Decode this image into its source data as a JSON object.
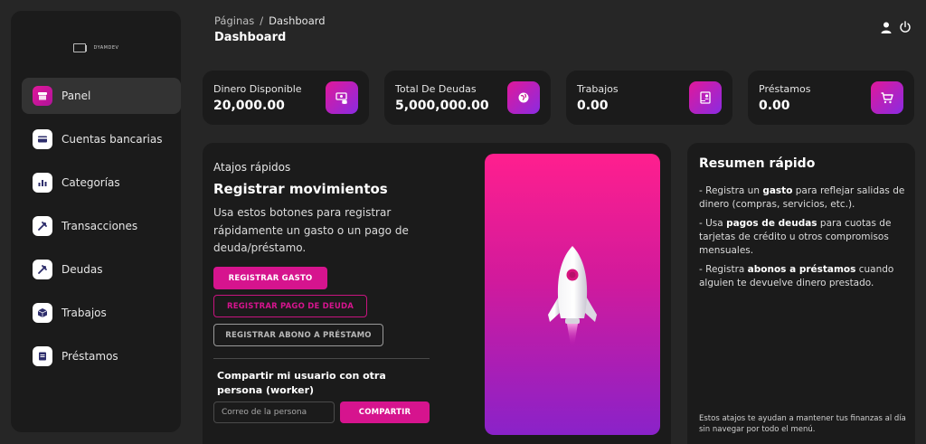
{
  "brand": {
    "logo_text": "DYAMDEV"
  },
  "sidebar": {
    "items": [
      {
        "label": "Panel",
        "icon": "store-icon",
        "active": true
      },
      {
        "label": "Cuentas bancarias",
        "icon": "credit-card-icon",
        "active": false
      },
      {
        "label": "Categorías",
        "icon": "chart-icon",
        "active": false
      },
      {
        "label": "Transacciones",
        "icon": "tools-icon",
        "active": false
      },
      {
        "label": "Deudas",
        "icon": "tools-icon",
        "active": false
      },
      {
        "label": "Trabajos",
        "icon": "box-icon",
        "active": false
      },
      {
        "label": "Préstamos",
        "icon": "document-icon",
        "active": false
      }
    ]
  },
  "header": {
    "breadcrumb_root": "Páginas",
    "breadcrumb_sep": "/",
    "breadcrumb_current": "Dashboard",
    "title": "Dashboard"
  },
  "stats": [
    {
      "label": "Dinero Disponible",
      "value": "20,000.00",
      "icon": "money-icon"
    },
    {
      "label": "Total De Deudas",
      "value": "5,000,000.00",
      "icon": "globe-icon"
    },
    {
      "label": "Trabajos",
      "value": "0.00",
      "icon": "badge-icon"
    },
    {
      "label": "Préstamos",
      "value": "0.00",
      "icon": "cart-icon"
    }
  ],
  "quick": {
    "label": "Atajos rápidos",
    "title": "Registrar movimientos",
    "description": "Usa estos botones para registrar rápidamente un gasto o un pago de deuda/préstamo.",
    "btn_gasto": "REGISTRAR GASTO",
    "btn_deuda": "REGISTRAR PAGO DE DEUDA",
    "btn_abono": "REGISTRAR ABONO A PRÉSTAMO",
    "share_title": "Compartir mi usuario con otra persona (worker)",
    "share_placeholder": "Correo de la persona",
    "share_button": "COMPARTIR"
  },
  "summary": {
    "title": "Resumen rápido",
    "items": [
      {
        "pre": "- Registra un ",
        "bold": "gasto",
        "post": " para reflejar salidas de dinero (compras, servicios, etc.)."
      },
      {
        "pre": "- Usa ",
        "bold": "pagos de deudas",
        "post": " para cuotas de tarjetas de crédito u otros compromisos mensuales."
      },
      {
        "pre": "- Registra ",
        "bold": "abonos a préstamos",
        "post": " cuando alguien te devuelve dinero prestado."
      }
    ],
    "footer": "Estos atajos te ayudan a mantener tus finanzas al día sin navegar por todo el menú."
  },
  "colors": {
    "accent": "#d6148e",
    "gradient_end": "#8a22c9",
    "card_bg": "#1b1b1b",
    "page_bg": "#262626"
  }
}
